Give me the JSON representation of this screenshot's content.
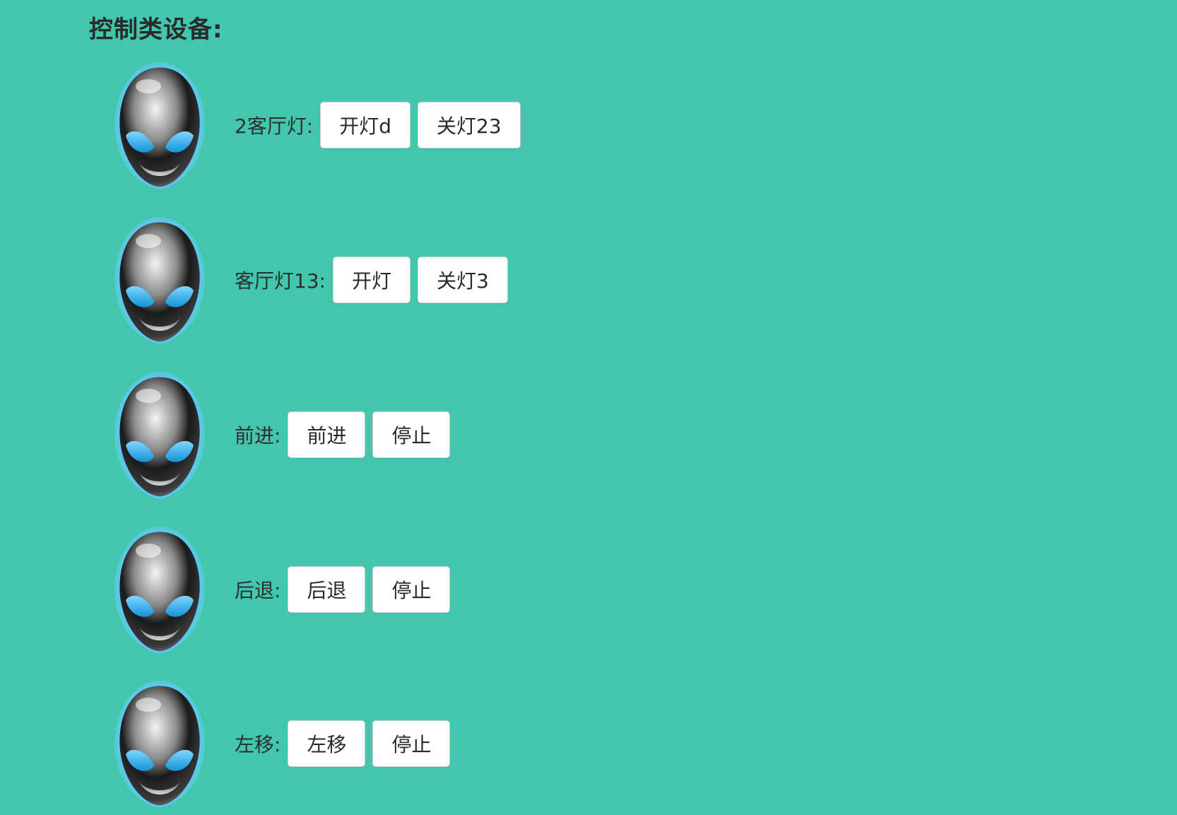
{
  "section": {
    "title": "控制类设备:"
  },
  "devices": [
    {
      "label": "2客厅灯:",
      "buttons": [
        "开灯d",
        "关灯23"
      ]
    },
    {
      "label": "客厅灯13:",
      "buttons": [
        "开灯",
        "关灯3"
      ]
    },
    {
      "label": "前进:",
      "buttons": [
        "前进",
        "停止"
      ]
    },
    {
      "label": "后退:",
      "buttons": [
        "后退",
        "停止"
      ]
    },
    {
      "label": "左移:",
      "buttons": [
        "左移",
        "停止"
      ]
    }
  ],
  "icon": {
    "name": "alien-head-icon"
  },
  "colors": {
    "background": "#42c6ae",
    "button": "#ffffff",
    "eye": "#2aa8e6"
  }
}
